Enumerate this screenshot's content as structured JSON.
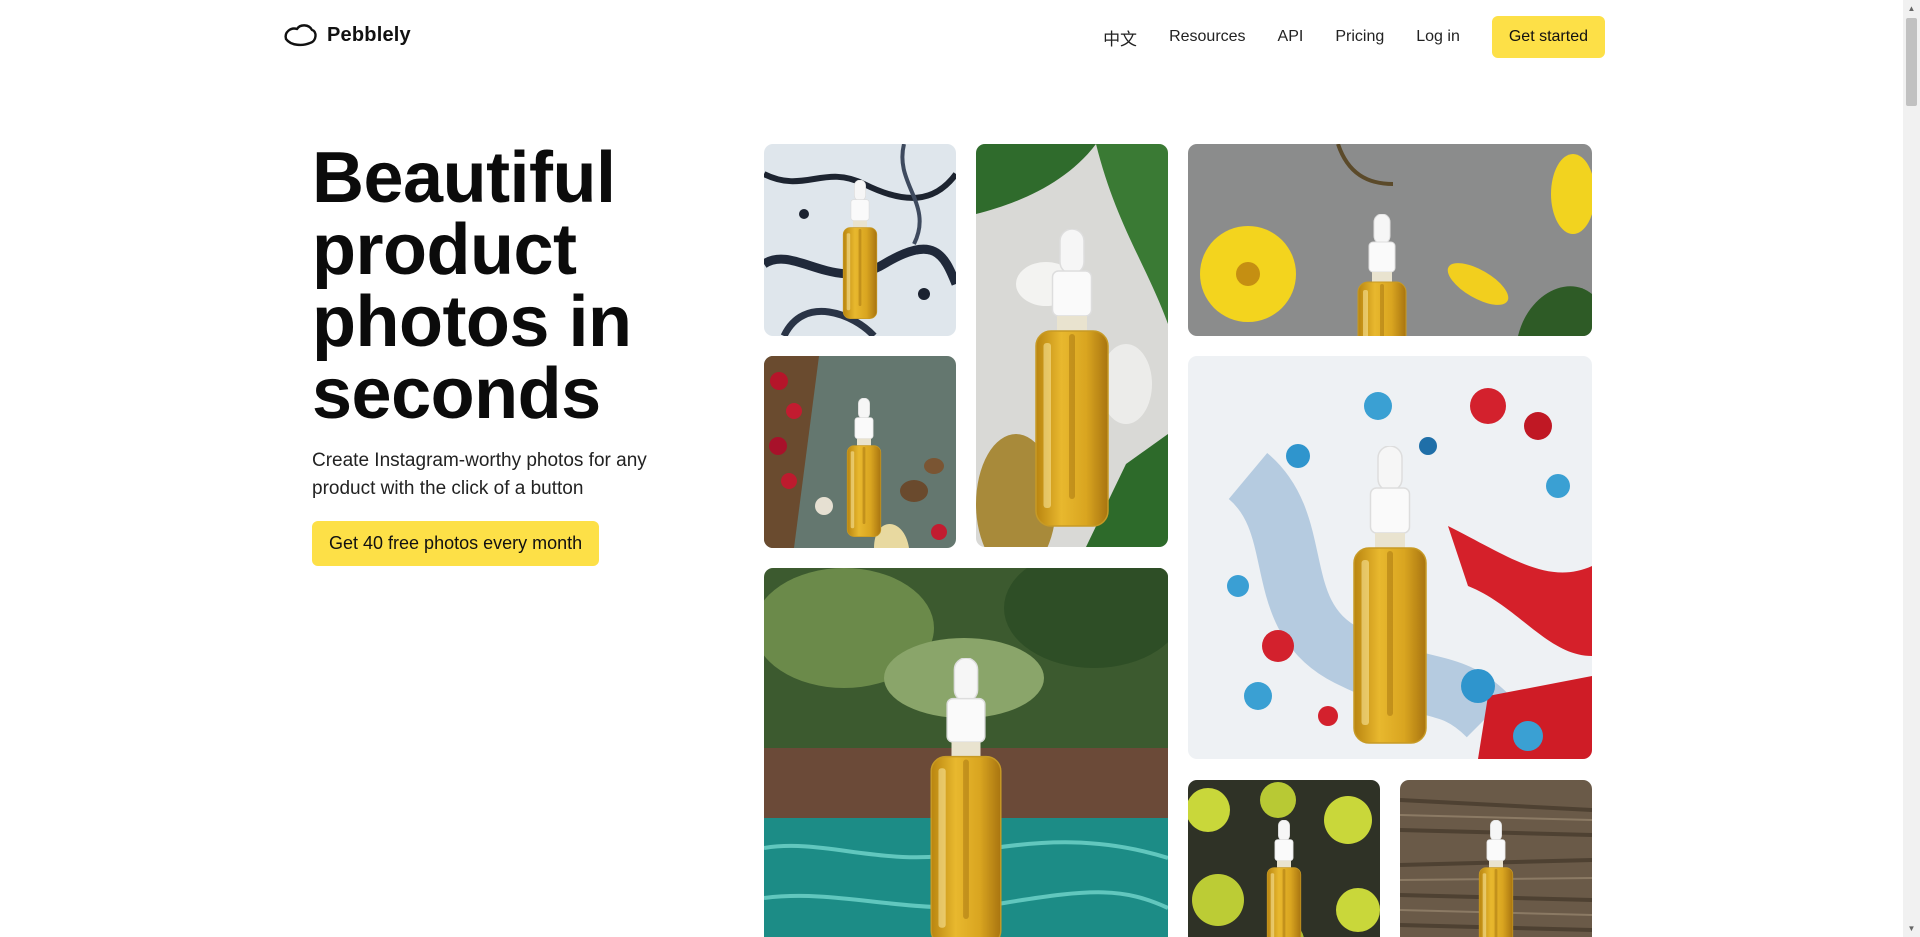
{
  "header": {
    "brand": "Pebblely",
    "nav": [
      {
        "label": "中文"
      },
      {
        "label": "Resources"
      },
      {
        "label": "API"
      },
      {
        "label": "Pricing"
      },
      {
        "label": "Log in"
      }
    ],
    "cta_label": "Get started"
  },
  "hero": {
    "title": "Beautiful product photos in seconds",
    "subtitle": "Create Instagram-worthy photos for any product with the click of a button",
    "cta_label": "Get 40 free photos every month"
  },
  "colors": {
    "accent": "#fde047",
    "text": "#111111",
    "background": "#ffffff",
    "oil": "#d9a520"
  },
  "gallery": [
    {
      "icon": "marble-dropper-bottle-photo"
    },
    {
      "icon": "water-stones-leaves-bottle-photo"
    },
    {
      "icon": "yellow-flowers-bottle-photo"
    },
    {
      "icon": "berries-nuts-bottle-photo"
    },
    {
      "icon": "paint-splatter-bottle-photo"
    },
    {
      "icon": "pool-jungle-bottle-photo"
    },
    {
      "icon": "yellow-leaves-bottle-photo"
    },
    {
      "icon": "wood-bark-bottle-photo"
    }
  ]
}
